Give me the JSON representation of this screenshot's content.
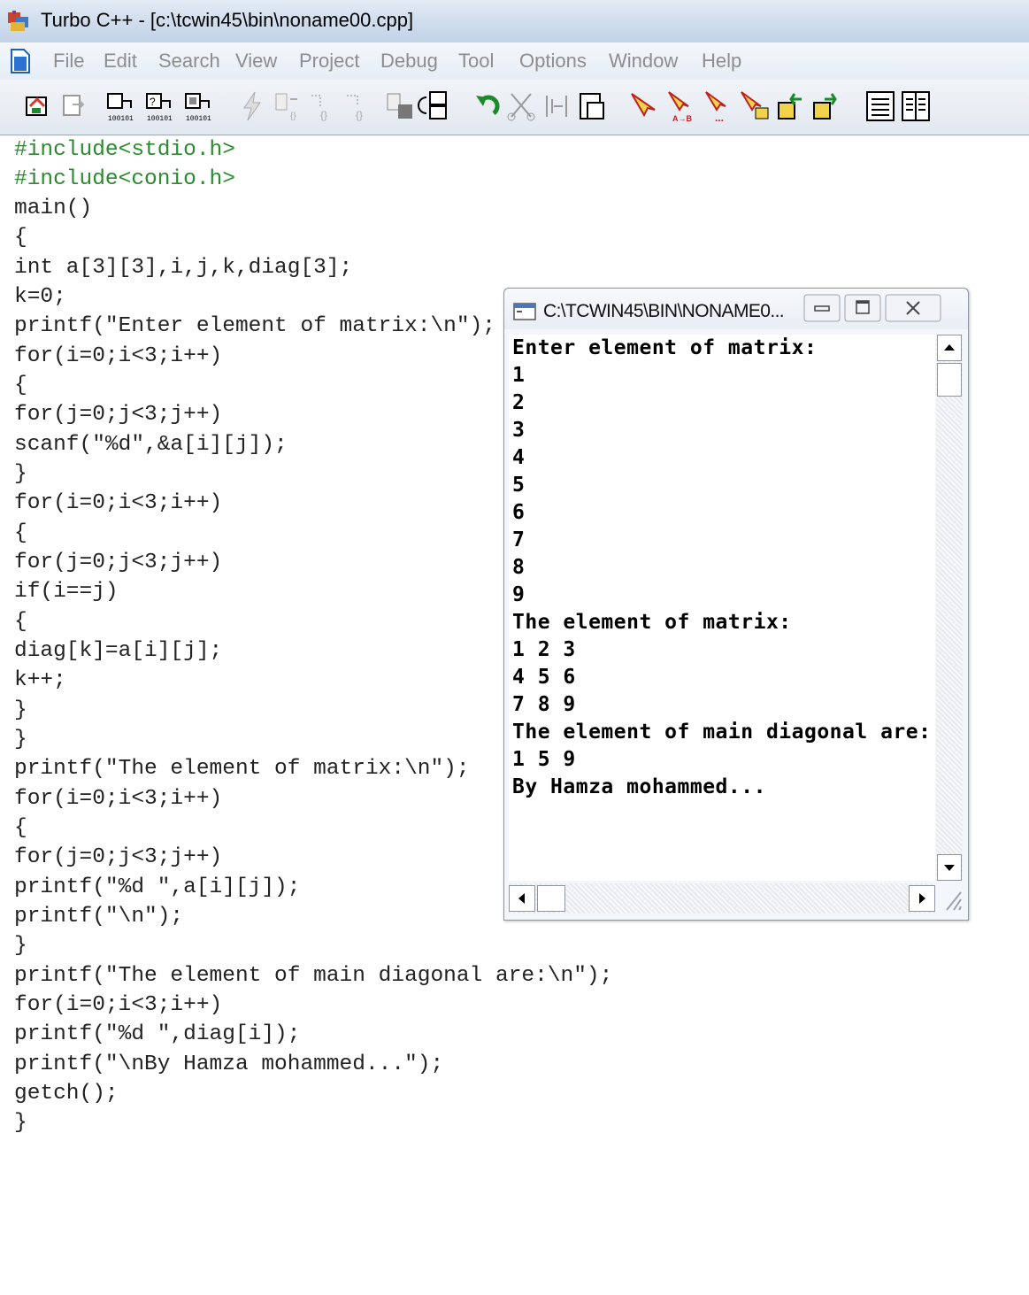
{
  "window": {
    "title": "Turbo C++ - [c:\\tcwin45\\bin\\noname00.cpp]"
  },
  "menu": {
    "items": [
      "File",
      "Edit",
      "Search",
      "View",
      "Project",
      "Debug",
      "Tool",
      "Options",
      "Window",
      "Help"
    ]
  },
  "toolbar": {
    "buttons": [
      "open-project-icon",
      "save-icon",
      "compile-icon",
      "make-icon",
      "build-all-icon",
      "speedbar-lightning-icon",
      "step-icon",
      "trace-icon",
      "inspect-icon",
      "browse-icon",
      "split-icon",
      "undo-icon",
      "cut-icon",
      "copy-icon",
      "paste-icon",
      "search-icon",
      "replace-icon",
      "search-again-icon",
      "browse-symbol-icon",
      "go-back-icon",
      "go-forward-icon",
      "message-window-icon",
      "tile-window-icon"
    ]
  },
  "editor": {
    "lines": [
      "#include<stdio.h>",
      "#include<conio.h>",
      "main()",
      "{",
      "int a[3][3],i,j,k,diag[3];",
      "k=0;",
      "printf(\"Enter element of matrix:\\n\");",
      "for(i=0;i<3;i++)",
      "{",
      "for(j=0;j<3;j++)",
      "scanf(\"%d\",&a[i][j]);",
      "}",
      "for(i=0;i<3;i++)",
      "{",
      "for(j=0;j<3;j++)",
      "if(i==j)",
      "{",
      "diag[k]=a[i][j];",
      "k++;",
      "}",
      "}",
      "printf(\"The element of matrix:\\n\");",
      "for(i=0;i<3;i++)",
      "{",
      "for(j=0;j<3;j++)",
      "printf(\"%d \",a[i][j]);",
      "printf(\"\\n\");",
      "}",
      "printf(\"The element of main diagonal are:\\n\");",
      "for(i=0;i<3;i++)",
      "printf(\"%d \",diag[i]);",
      "printf(\"\\nBy Hamza mohammed...\");",
      "getch();",
      "}"
    ]
  },
  "console": {
    "title": "C:\\TCWIN45\\BIN\\NONAME0...",
    "output": [
      "Enter element of matrix:",
      "1",
      "2",
      "3",
      "4",
      "5",
      "6",
      "7",
      "8",
      "9",
      "The element of matrix:",
      "1 2 3",
      "4 5 6",
      "7 8 9",
      "The element of main diagonal are:",
      "1 5 9",
      "By Hamza mohammed..."
    ]
  },
  "colors": {
    "preprocessor": "#2c8a30",
    "string_literal": "#1f2fa8",
    "menu_disabled": "#8d8d8d",
    "titlebar": "#cfdcec"
  }
}
